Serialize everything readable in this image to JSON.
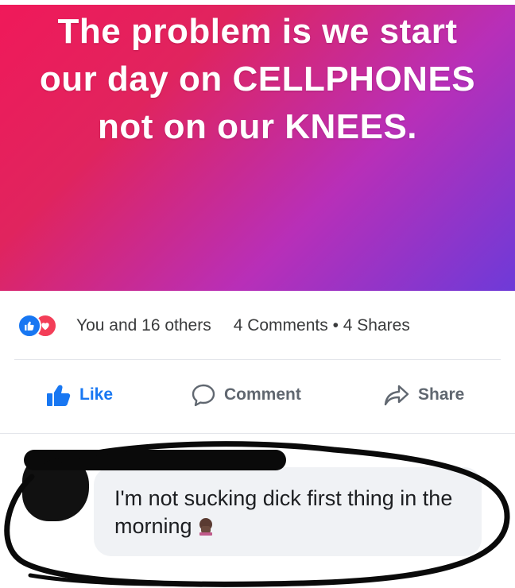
{
  "post": {
    "image_text": "The problem is we start our day on CELLPHONES not on our KNEES.",
    "gradient": [
      "#f0195a",
      "#b82fb8",
      "#6e3ad8"
    ]
  },
  "stats": {
    "reactions_text": "You and 16 others",
    "comments_shares_text": "4 Comments • 4 Shares",
    "reaction_icons": [
      "like-icon",
      "love-icon"
    ]
  },
  "actions": {
    "like_label": "Like",
    "comment_label": "Comment",
    "share_label": "Share"
  },
  "comment": {
    "text": "I'm not sucking dick first thing in the morning",
    "emoji": "person-facepalm-emoji",
    "bubble_color": "#f0f2f5"
  },
  "colors": {
    "accent": "#1877f2",
    "love": "#f33e58",
    "text_muted": "#606770"
  }
}
